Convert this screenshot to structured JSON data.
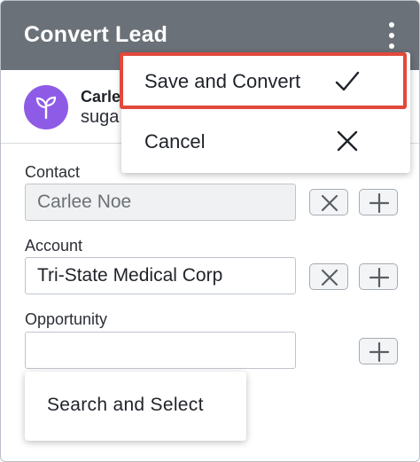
{
  "header": {
    "title": "Convert Lead",
    "menu_icon": "kebab-menu-icon"
  },
  "record": {
    "name": "Carlee",
    "subtitle": "suga",
    "avatar_icon": "sprout-icon",
    "avatar_color": "#8e5be6"
  },
  "fields": {
    "contact": {
      "label": "Contact",
      "value": "Carlee Noe"
    },
    "account": {
      "label": "Account",
      "value": "Tri-State Medical Corp"
    },
    "opportunity": {
      "label": "Opportunity",
      "value": ""
    }
  },
  "menu": {
    "items": [
      {
        "label": "Save and Convert",
        "icon": "checkmark-icon",
        "highlighted": true
      },
      {
        "label": "Cancel",
        "icon": "close-icon"
      }
    ]
  },
  "popup": {
    "label": "Search and Select"
  },
  "colors": {
    "header_bg": "#6b7178",
    "highlight": "#e2483b"
  }
}
